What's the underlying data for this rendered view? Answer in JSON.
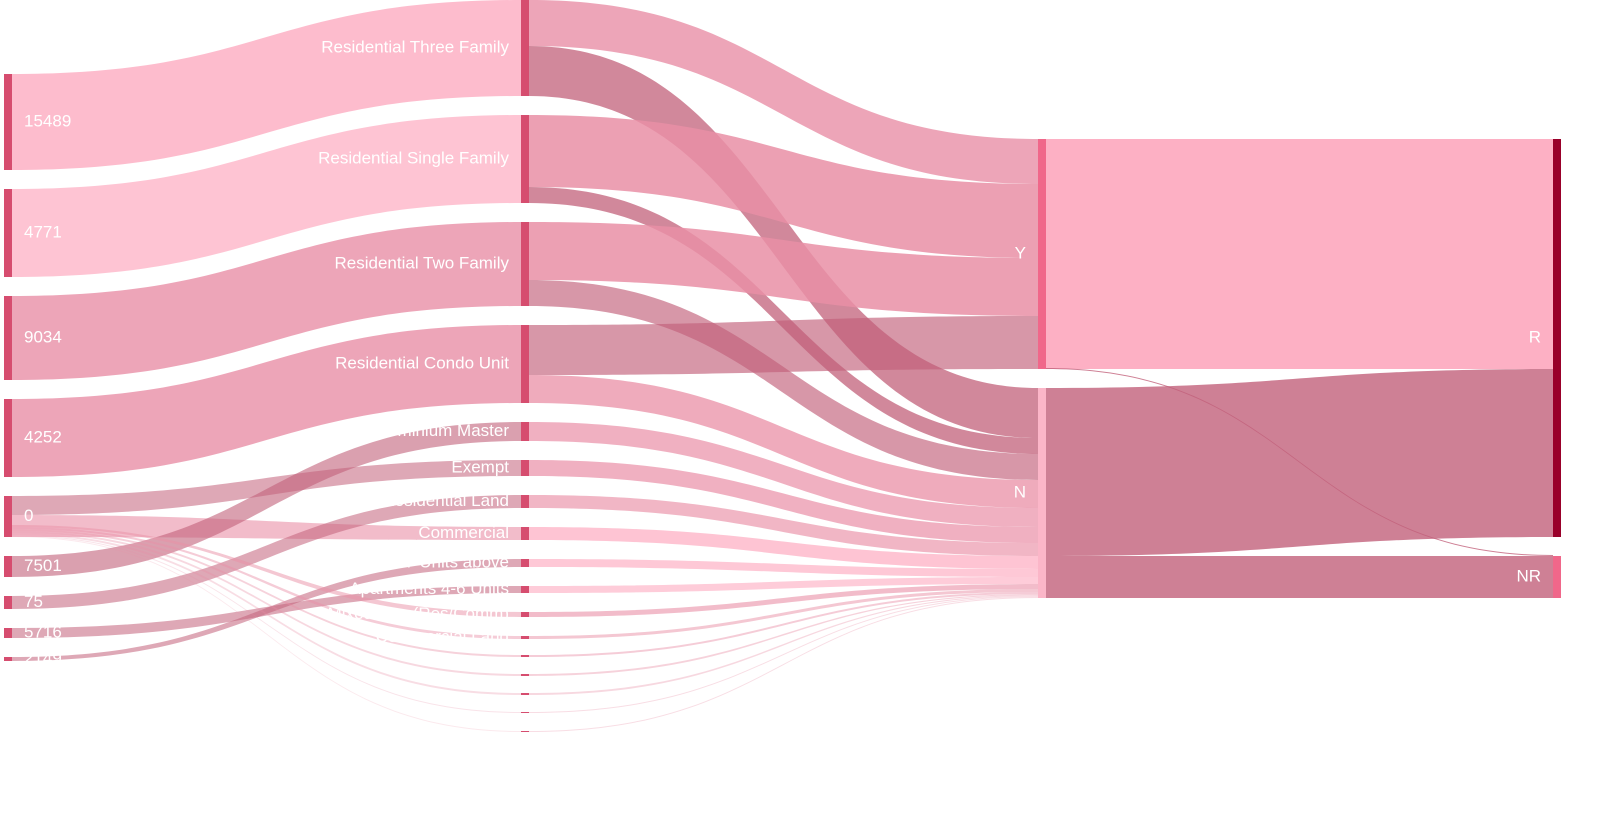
{
  "diagram": {
    "type": "sankey",
    "columns": [
      [
        "15489",
        "4771",
        "9034",
        "4252",
        "0",
        "7501",
        "75",
        "5716",
        "2149"
      ],
      [
        "Residential Three Family",
        "Residential Single Family",
        "Residential Two Family",
        "Residential Condo Unit",
        "Condominium Master",
        "Exempt",
        "Residential Land",
        "Commercial",
        "Apartments 7 Units above",
        "Apartments 4-6 Units",
        "Mixed Use (Res/Comm)",
        "Commercial Land",
        "",
        "",
        "",
        "",
        ""
      ],
      [
        "Y",
        "N"
      ],
      [
        "R",
        "NR"
      ]
    ]
  },
  "colors": {
    "column_0_nodes": "#d64d6f",
    "column_1_nodes": "#d64d6f",
    "y_node": "#f0678a",
    "n_node": "#fbb6c8",
    "r_node": "#99002a",
    "nr_node": "#f0678a",
    "link_light": "#fdb0c4",
    "link_mid": "#e98fa6",
    "link_dark": "#c2607a"
  }
}
